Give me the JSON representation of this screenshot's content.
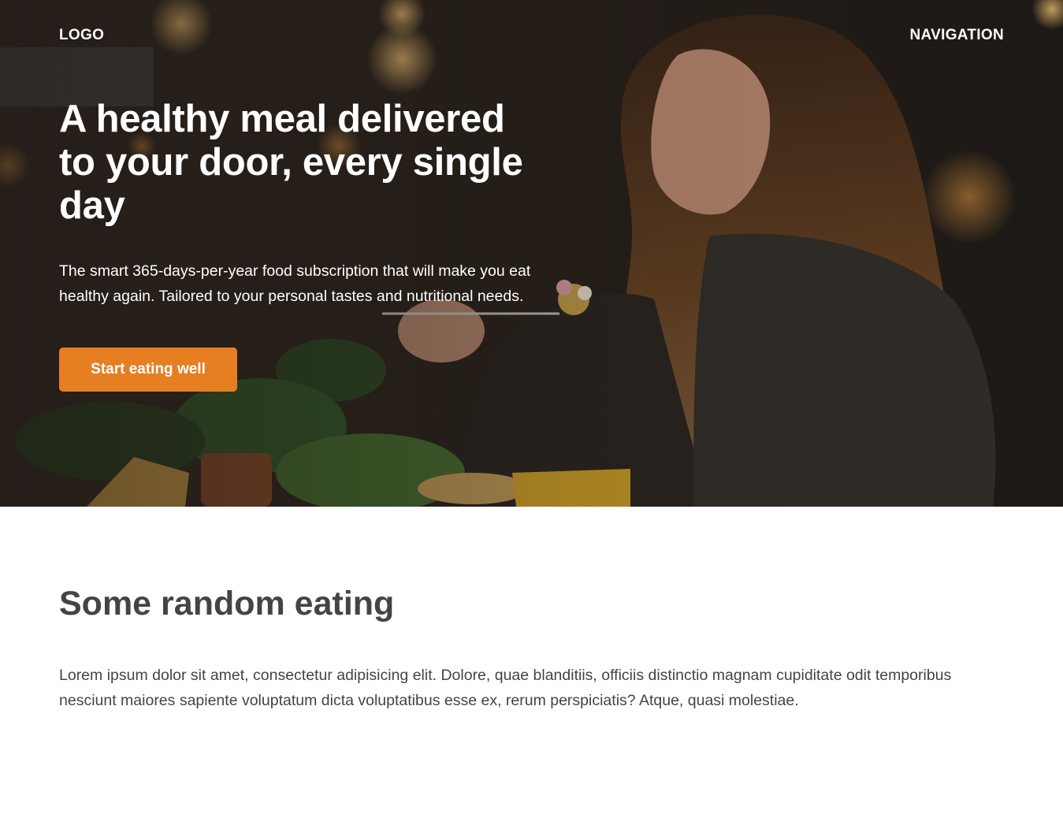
{
  "header": {
    "logo": "LOGO",
    "navigation": "NAVIGATION"
  },
  "hero": {
    "title": "A healthy meal delivered to your door, every single day",
    "text": "The smart 365-days-per-year food subscription that will make you eat healthy again. Tailored to your personal tastes and nutritional needs.",
    "cta_label": "Start eating well"
  },
  "section": {
    "title": "Some random eating",
    "text": "Lorem ipsum dolor sit amet, consectetur adipisicing elit. Dolore, quae blanditiis, officiis distinctio magnam cupiditate odit temporibus nesciunt maiores sapiente voluptatum dicta voluptatibus esse ex, rerum perspiciatis? Atque, quasi molestiae."
  },
  "colors": {
    "accent": "#e67e22",
    "text_dark": "#444444",
    "hero_text": "#ffffff"
  }
}
